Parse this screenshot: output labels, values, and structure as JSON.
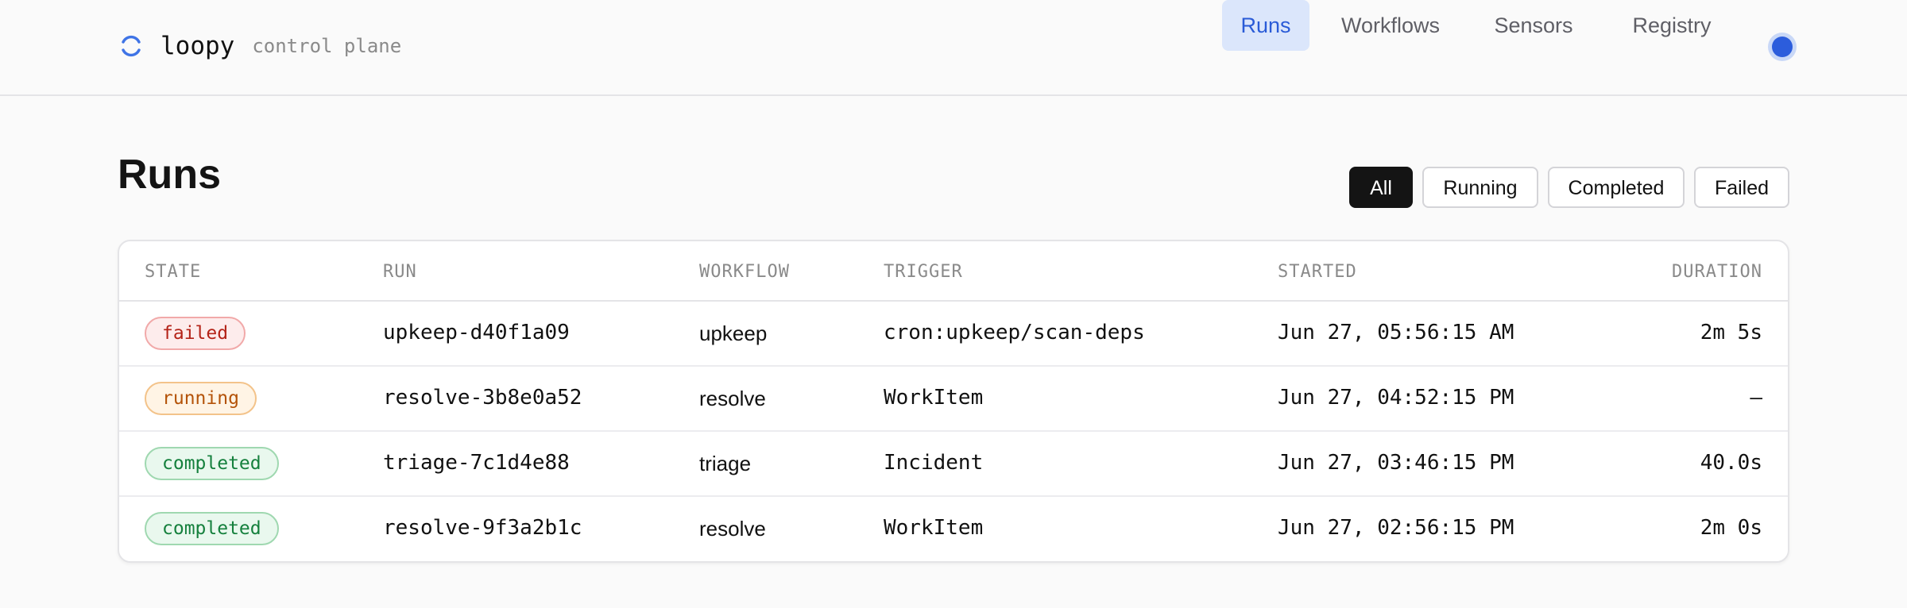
{
  "header": {
    "brand_name": "loopy",
    "brand_sub": "control plane",
    "nav": [
      {
        "label": "Runs",
        "active": true
      },
      {
        "label": "Workflows",
        "active": false
      },
      {
        "label": "Sensors",
        "active": false
      },
      {
        "label": "Registry",
        "active": false
      }
    ],
    "status_color": "#2c5ddc"
  },
  "page": {
    "title": "Runs"
  },
  "filters": [
    {
      "label": "All",
      "active": true
    },
    {
      "label": "Running",
      "active": false
    },
    {
      "label": "Completed",
      "active": false
    },
    {
      "label": "Failed",
      "active": false
    }
  ],
  "table": {
    "columns": [
      "STATE",
      "RUN",
      "WORKFLOW",
      "TRIGGER",
      "STARTED",
      "DURATION"
    ],
    "rows": [
      {
        "state": "failed",
        "run": "upkeep-d40f1a09",
        "workflow": "upkeep",
        "trigger": "cron:upkeep/scan-deps",
        "started": "Jun 27, 05:56:15 AM",
        "duration": "2m 5s"
      },
      {
        "state": "running",
        "run": "resolve-3b8e0a52",
        "workflow": "resolve",
        "trigger": "WorkItem",
        "started": "Jun 27, 04:52:15 PM",
        "duration": "—"
      },
      {
        "state": "completed",
        "run": "triage-7c1d4e88",
        "workflow": "triage",
        "trigger": "Incident",
        "started": "Jun 27, 03:46:15 PM",
        "duration": "40.0s"
      },
      {
        "state": "completed",
        "run": "resolve-9f3a2b1c",
        "workflow": "resolve",
        "trigger": "WorkItem",
        "started": "Jun 27, 02:56:15 PM",
        "duration": "2m 0s"
      }
    ]
  },
  "colors": {
    "accent": "#2a5bd7",
    "failed": "#b42318",
    "running": "#b45309",
    "completed": "#15803d"
  }
}
